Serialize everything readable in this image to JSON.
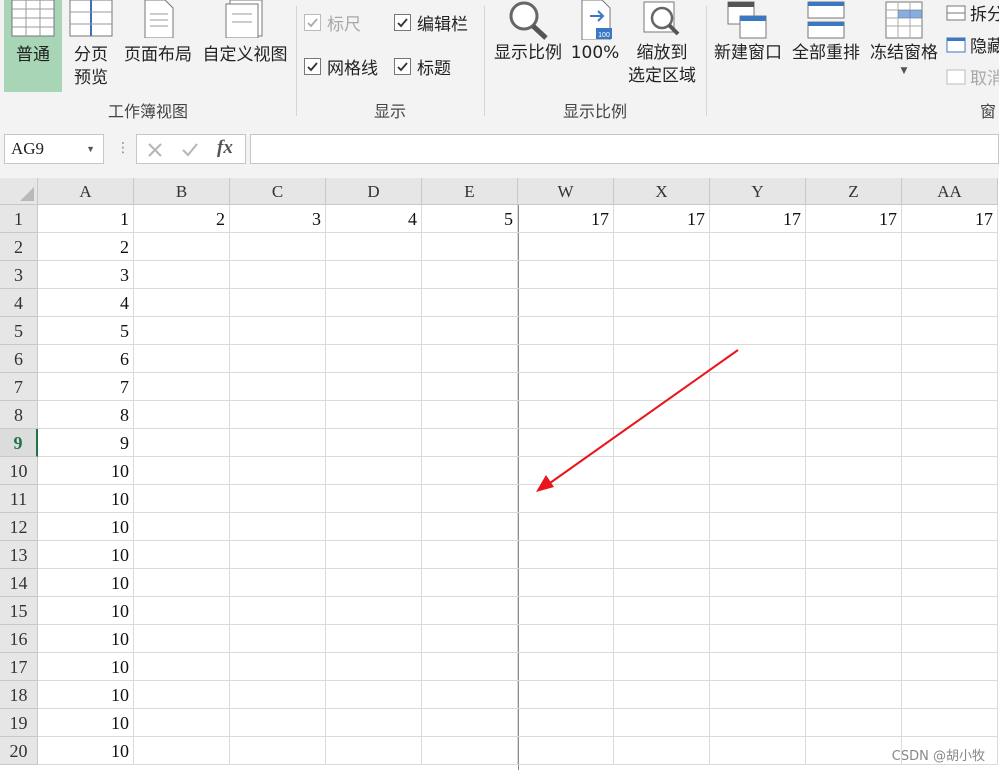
{
  "ribbon": {
    "workbook_views": {
      "normal": "普通",
      "page_break_line1": "分页",
      "page_break_line2": "预览",
      "page_layout": "页面布局",
      "custom_views": "自定义视图",
      "group_label": "工作簿视图"
    },
    "show": {
      "ruler": "标尺",
      "formula_bar": "编辑栏",
      "gridlines": "网格线",
      "headings": "标题",
      "group_label": "显示"
    },
    "zoom": {
      "zoom": "显示比例",
      "zoom100": "100%",
      "zoom_to_selection_line1": "缩放到",
      "zoom_to_selection_line2": "选定区域",
      "zoom100_badge": "100",
      "group_label": "显示比例"
    },
    "window": {
      "new_window": "新建窗口",
      "arrange_all": "全部重排",
      "freeze_panes": "冻结窗格",
      "split": "拆分",
      "hide": "隐藏",
      "unhide": "取消",
      "group_label": "窗"
    }
  },
  "formula_bar": {
    "name_box": "AG9",
    "fx_label": "fx",
    "formula_value": ""
  },
  "grid": {
    "columns": [
      "A",
      "B",
      "C",
      "D",
      "E",
      "W",
      "X",
      "Y",
      "Z",
      "AA"
    ],
    "active_row": "9",
    "rows": [
      {
        "num": "1",
        "cells": [
          "1",
          "2",
          "3",
          "4",
          "5",
          "17",
          "17",
          "17",
          "17",
          "17"
        ]
      },
      {
        "num": "2",
        "cells": [
          "2",
          "",
          "",
          "",
          "",
          "",
          "",
          "",
          "",
          ""
        ]
      },
      {
        "num": "3",
        "cells": [
          "3",
          "",
          "",
          "",
          "",
          "",
          "",
          "",
          "",
          ""
        ]
      },
      {
        "num": "4",
        "cells": [
          "4",
          "",
          "",
          "",
          "",
          "",
          "",
          "",
          "",
          ""
        ]
      },
      {
        "num": "5",
        "cells": [
          "5",
          "",
          "",
          "",
          "",
          "",
          "",
          "",
          "",
          ""
        ]
      },
      {
        "num": "6",
        "cells": [
          "6",
          "",
          "",
          "",
          "",
          "",
          "",
          "",
          "",
          ""
        ]
      },
      {
        "num": "7",
        "cells": [
          "7",
          "",
          "",
          "",
          "",
          "",
          "",
          "",
          "",
          ""
        ]
      },
      {
        "num": "8",
        "cells": [
          "8",
          "",
          "",
          "",
          "",
          "",
          "",
          "",
          "",
          ""
        ]
      },
      {
        "num": "9",
        "cells": [
          "9",
          "",
          "",
          "",
          "",
          "",
          "",
          "",
          "",
          ""
        ]
      },
      {
        "num": "10",
        "cells": [
          "10",
          "",
          "",
          "",
          "",
          "",
          "",
          "",
          "",
          ""
        ]
      },
      {
        "num": "11",
        "cells": [
          "10",
          "",
          "",
          "",
          "",
          "",
          "",
          "",
          "",
          ""
        ]
      },
      {
        "num": "12",
        "cells": [
          "10",
          "",
          "",
          "",
          "",
          "",
          "",
          "",
          "",
          ""
        ]
      },
      {
        "num": "13",
        "cells": [
          "10",
          "",
          "",
          "",
          "",
          "",
          "",
          "",
          "",
          ""
        ]
      },
      {
        "num": "14",
        "cells": [
          "10",
          "",
          "",
          "",
          "",
          "",
          "",
          "",
          "",
          ""
        ]
      },
      {
        "num": "15",
        "cells": [
          "10",
          "",
          "",
          "",
          "",
          "",
          "",
          "",
          "",
          ""
        ]
      },
      {
        "num": "16",
        "cells": [
          "10",
          "",
          "",
          "",
          "",
          "",
          "",
          "",
          "",
          ""
        ]
      },
      {
        "num": "17",
        "cells": [
          "10",
          "",
          "",
          "",
          "",
          "",
          "",
          "",
          "",
          ""
        ]
      },
      {
        "num": "18",
        "cells": [
          "10",
          "",
          "",
          "",
          "",
          "",
          "",
          "",
          "",
          ""
        ]
      },
      {
        "num": "19",
        "cells": [
          "10",
          "",
          "",
          "",
          "",
          "",
          "",
          "",
          "",
          ""
        ]
      },
      {
        "num": "20",
        "cells": [
          "10",
          "",
          "",
          "",
          "",
          "",
          "",
          "",
          "",
          ""
        ]
      }
    ]
  },
  "watermark": "CSDN @胡小牧",
  "colors": {
    "accent_green": "#217346",
    "normal_view_highlight": "#a7d5b5",
    "annotation_arrow": "#e8151b"
  }
}
